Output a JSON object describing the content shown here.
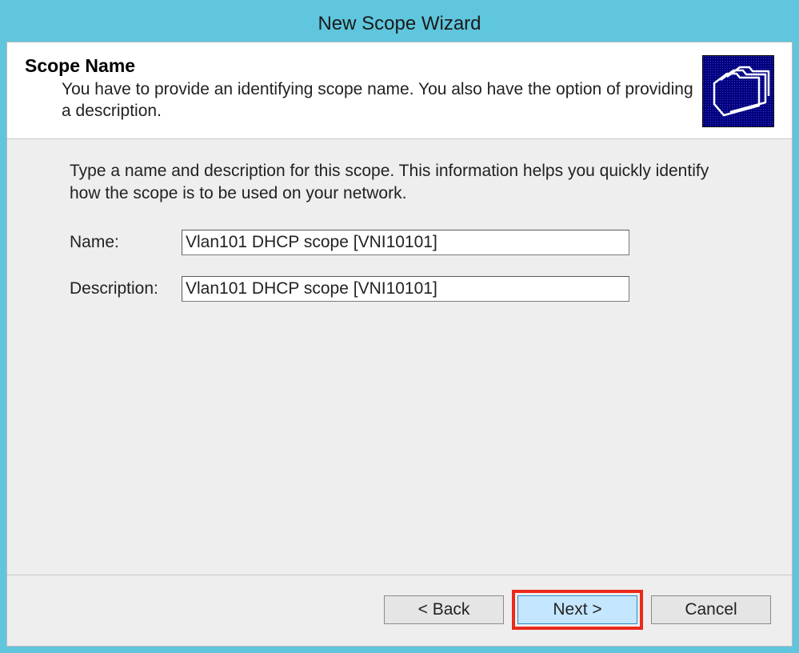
{
  "window": {
    "title": "New Scope Wizard"
  },
  "header": {
    "title": "Scope Name",
    "subtitle": "You have to provide an identifying scope name. You also have the option of providing a description."
  },
  "content": {
    "instruction": "Type a name and description for this scope. This information helps you quickly identify how the scope is to be used on your network.",
    "name_label": "Name:",
    "name_value": "Vlan101 DHCP scope [VNI10101]",
    "description_label": "Description:",
    "description_value": "Vlan101 DHCP scope [VNI10101]"
  },
  "buttons": {
    "back": "< Back",
    "next": "Next >",
    "cancel": "Cancel"
  }
}
